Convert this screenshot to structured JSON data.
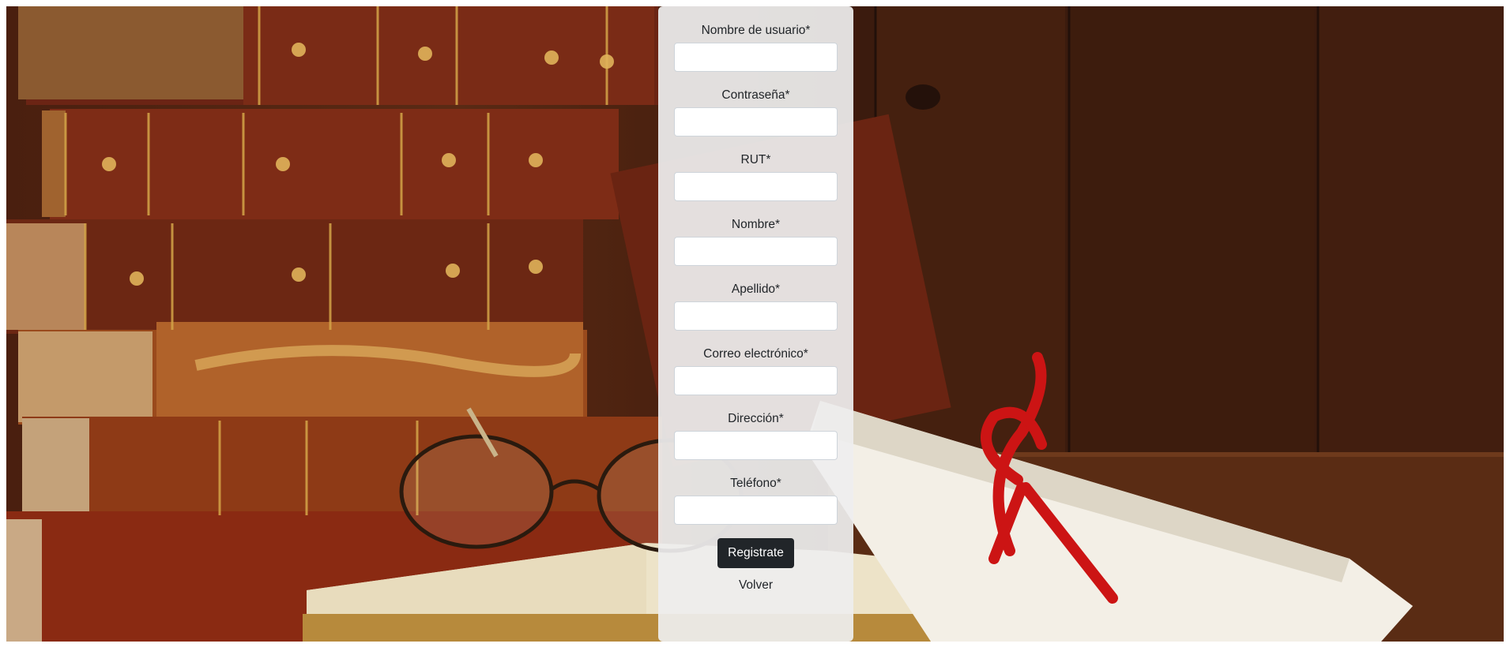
{
  "background": {
    "image": "old-books-diploma-photo"
  },
  "form": {
    "fields": [
      {
        "label": "Nombre de usuario*",
        "value": ""
      },
      {
        "label": "Contraseña*",
        "value": ""
      },
      {
        "label": "RUT*",
        "value": ""
      },
      {
        "label": "Nombre*",
        "value": ""
      },
      {
        "label": "Apellido*",
        "value": ""
      },
      {
        "label": "Correo electrónico*",
        "value": ""
      },
      {
        "label": "Dirección*",
        "value": ""
      },
      {
        "label": "Teléfono*",
        "value": ""
      }
    ],
    "submit_label": "Registrate",
    "back_label": "Volver"
  },
  "colors": {
    "panel": "#eeeeee",
    "button": "#212529",
    "text": "#212529"
  }
}
